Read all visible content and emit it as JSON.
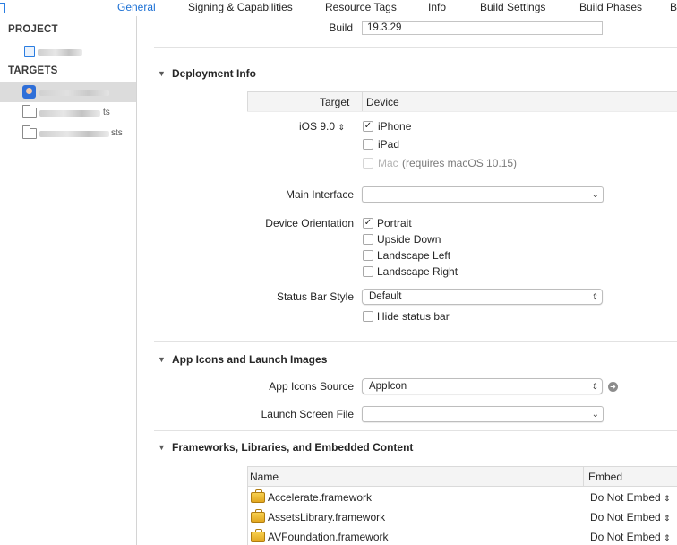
{
  "tabs": [
    "General",
    "Signing & Capabilities",
    "Resource Tags",
    "Info",
    "Build Settings",
    "Build Phases",
    "B"
  ],
  "sidebar": {
    "project_header": "PROJECT",
    "targets_header": "TARGETS",
    "items": [
      {
        "label_fragment": "",
        "icon": "project-icon"
      },
      {
        "label_fragment": "",
        "icon": "app-target-icon"
      },
      {
        "label_fragment": "ts",
        "icon": "test-target-icon"
      },
      {
        "label_fragment": "sts",
        "icon": "test-target-icon"
      }
    ]
  },
  "identity": {
    "build_label": "Build",
    "build_value": "19.3.29"
  },
  "deployment": {
    "title": "Deployment Info",
    "target_col": "Target",
    "device_col": "Device",
    "ios_version": "iOS 9.0",
    "devices": [
      {
        "label": "iPhone",
        "checked": true,
        "disabled": false,
        "note": ""
      },
      {
        "label": "iPad",
        "checked": false,
        "disabled": false,
        "note": ""
      },
      {
        "label": "Mac",
        "checked": false,
        "disabled": true,
        "note": "(requires macOS 10.15)"
      }
    ],
    "main_interface_label": "Main Interface",
    "main_interface_value": "",
    "orientation_label": "Device Orientation",
    "orientations": [
      {
        "label": "Portrait",
        "checked": true
      },
      {
        "label": "Upside Down",
        "checked": false
      },
      {
        "label": "Landscape Left",
        "checked": false
      },
      {
        "label": "Landscape Right",
        "checked": false
      }
    ],
    "status_bar_label": "Status Bar Style",
    "status_bar_value": "Default",
    "hide_status_bar": {
      "label": "Hide status bar",
      "checked": false
    }
  },
  "app_icons": {
    "title": "App Icons and Launch Images",
    "source_label": "App Icons Source",
    "source_value": "AppIcon",
    "launch_label": "Launch Screen File",
    "launch_value": ""
  },
  "frameworks": {
    "title": "Frameworks, Libraries, and Embedded Content",
    "name_col": "Name",
    "embed_col": "Embed",
    "rows": [
      {
        "name": "Accelerate.framework",
        "embed": "Do Not Embed"
      },
      {
        "name": "AssetsLibrary.framework",
        "embed": "Do Not Embed"
      },
      {
        "name": "AVFoundation.framework",
        "embed": "Do Not Embed"
      }
    ]
  },
  "colors": {
    "accent": "#1a6fd4",
    "selection": "#dcdcdc"
  }
}
